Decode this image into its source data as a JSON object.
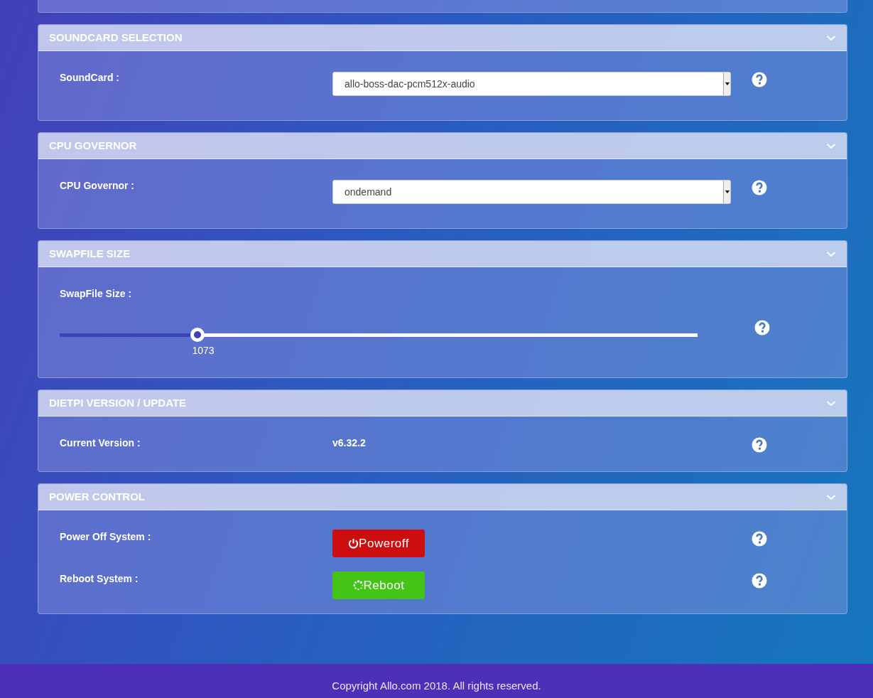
{
  "panels": [
    {
      "title": "SOUNDCARD SELECTION",
      "expanded": true,
      "rows": [
        {
          "kind": "select",
          "label": "SoundCard :",
          "value": "allo-boss-dac-pcm512x-audio"
        }
      ]
    },
    {
      "title": "CPU GOVERNOR",
      "expanded": true,
      "rows": [
        {
          "kind": "select",
          "label": "CPU Governor :",
          "value": "ondemand"
        }
      ]
    },
    {
      "title": "SWAPFILE SIZE",
      "expanded": true,
      "rows": [
        {
          "kind": "slider",
          "label": "SwapFile Size :",
          "level": 0.216,
          "reading": "1073"
        }
      ]
    },
    {
      "title": "DIETPI VERSION / UPDATE",
      "expanded": true,
      "rows": [
        {
          "kind": "text",
          "label": "Current Version :",
          "value": "v6.32.2"
        }
      ]
    },
    {
      "title": "POWER CONTROL",
      "expanded": true,
      "rows": [
        {
          "kind": "poweroff",
          "label": "Power Off System :",
          "button": "Poweroff"
        },
        {
          "kind": "reboot",
          "label": "Reboot System :",
          "button": "Reboot"
        }
      ]
    }
  ],
  "footer": "Copyright Allo.com 2018. All rights reserved."
}
